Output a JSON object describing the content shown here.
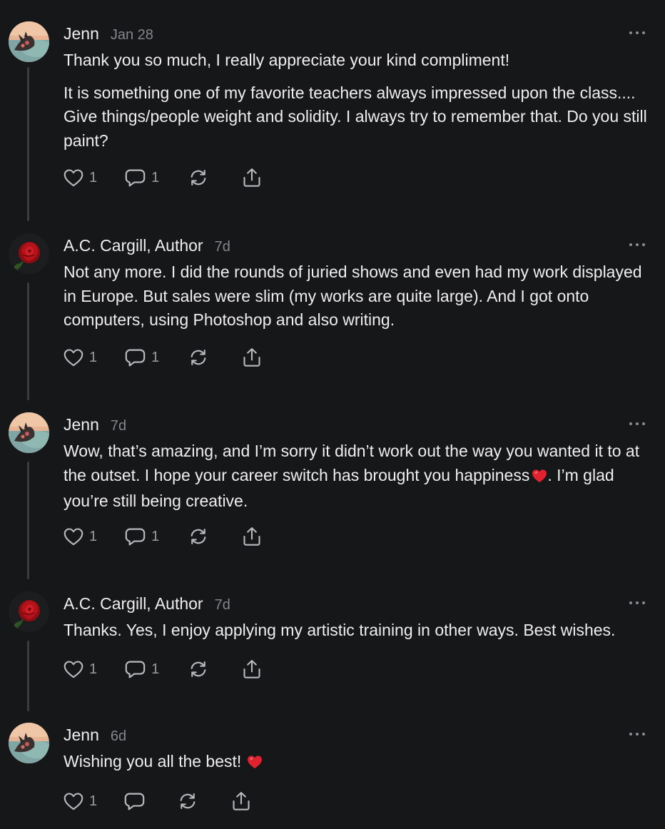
{
  "comments": [
    {
      "author": "Jenn",
      "time": "Jan 28",
      "avatar": "landscape-avatar",
      "paragraphs": [
        "Thank you so much, I really appreciate your kind compliment!",
        "It is something one of my favorite teachers always impressed upon the class.... Give things/people weight and solidity. I always try to remember that. Do you still paint?"
      ],
      "likes": "1",
      "replies": "1"
    },
    {
      "author": "A.C. Cargill, Author",
      "time": "7d",
      "avatar": "rose-avatar",
      "paragraphs": [
        "Not any more. I did the rounds of juried shows and even had my work displayed in Europe. But sales were slim (my works are quite large). And I got onto computers, using Photoshop and also writing."
      ],
      "likes": "1",
      "replies": "1"
    },
    {
      "author": "Jenn",
      "time": "7d",
      "avatar": "landscape-avatar",
      "paragraphs": [
        "Wow, that’s amazing, and I’m sorry it didn’t work out the way you wanted it to at the outset. I hope your career switch has brought you happiness",
        ". I’m glad you’re still being creative."
      ],
      "likes": "1",
      "replies": "1"
    },
    {
      "author": "A.C. Cargill, Author",
      "time": "7d",
      "avatar": "rose-avatar",
      "paragraphs": [
        "Thanks. Yes, I enjoy applying my artistic training in other ways. Best wishes."
      ],
      "likes": "1",
      "replies": "1"
    },
    {
      "author": "Jenn",
      "time": "6d",
      "avatar": "landscape-avatar",
      "paragraphs": [
        "Wishing you all the best!"
      ],
      "likes": "1",
      "replies": ""
    }
  ],
  "icons": {
    "like": "heart-outline-icon",
    "reply": "speech-bubble-icon",
    "restack": "restack-arrows-icon",
    "share": "share-upload-icon",
    "more": "more-dots-icon",
    "emoji": "red-heart-emoji"
  },
  "colors": {
    "background": "#161719",
    "text": "#eeeeef",
    "muted": "#85868a",
    "heart_emoji": "#e0232e"
  }
}
